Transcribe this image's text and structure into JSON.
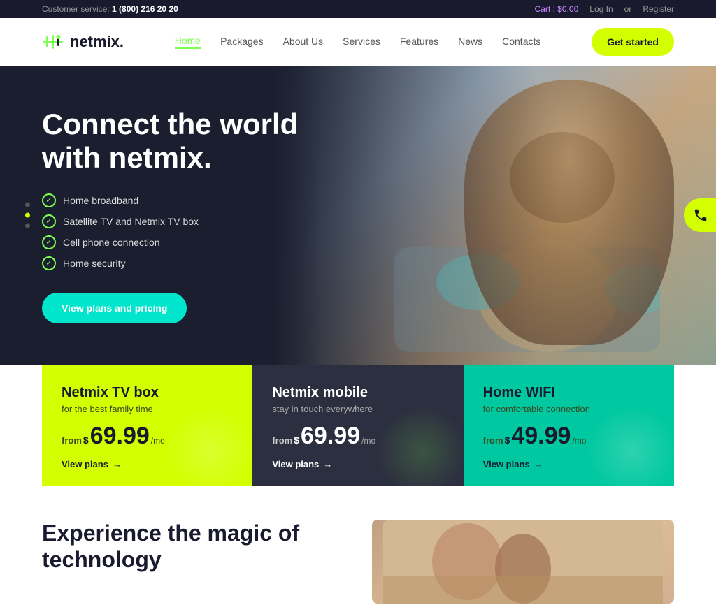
{
  "topbar": {
    "customer_service_label": "Customer service:",
    "phone": "1 (800) 216 20 20",
    "cart_label": "Cart :",
    "cart_amount": "$0.00",
    "login_label": "Log In",
    "or_label": "or",
    "register_label": "Register"
  },
  "header": {
    "logo_text": "netmix.",
    "nav": {
      "home": "Home",
      "packages": "Packages",
      "about_us": "About Us",
      "services": "Services",
      "features": "Features",
      "news": "News",
      "contacts": "Contacts"
    },
    "cta_button": "Get started"
  },
  "hero": {
    "heading": "Connect the world with netmix.",
    "features": [
      "Home broadband",
      "Satellite TV and Netmix TV box",
      "Cell phone connection",
      "Home security"
    ],
    "cta_button": "View plans and pricing"
  },
  "slider": {
    "dots": [
      {
        "active": false
      },
      {
        "active": true
      },
      {
        "active": false
      }
    ]
  },
  "cards": [
    {
      "id": "tv-box",
      "title": "Netmix TV box",
      "subtitle": "for the best family time",
      "from": "from",
      "currency": "$",
      "amount": "69.99",
      "period": "/mo",
      "link_text": "View plans",
      "link_arrow": "→",
      "color": "yellow"
    },
    {
      "id": "mobile",
      "title": "Netmix mobile",
      "subtitle": "stay in touch everywhere",
      "from": "from",
      "currency": "$",
      "amount": "69.99",
      "period": "/mo",
      "link_text": "View plans",
      "link_arrow": "→",
      "color": "dark"
    },
    {
      "id": "wifi",
      "title": "Home WIFI",
      "subtitle": "for comfortable connection",
      "from": "from",
      "currency": "$",
      "amount": "49.99",
      "period": "/mo",
      "link_text": "View plans",
      "link_arrow": "→",
      "color": "teal"
    }
  ],
  "bottom": {
    "heading_line1": "Experience the magic of",
    "heading_line2": "technology"
  },
  "colors": {
    "accent_green": "#d4ff00",
    "accent_teal": "#00c8a0",
    "dark_bg": "#1a1e2e",
    "card_dark": "#2c2f3f"
  }
}
